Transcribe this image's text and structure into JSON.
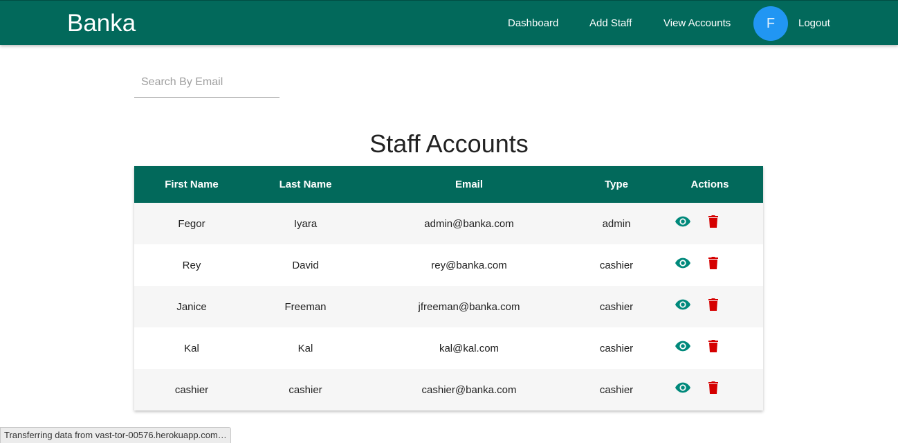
{
  "nav": {
    "brand": "Banka",
    "links": {
      "dashboard": "Dashboard",
      "add_staff": "Add Staff",
      "view_accounts": "View Accounts",
      "logout": "Logout"
    },
    "avatar_letter": "F"
  },
  "search": {
    "placeholder": "Search By Email",
    "value": ""
  },
  "page_title": "Staff Accounts",
  "table": {
    "headers": [
      "First Name",
      "Last Name",
      "Email",
      "Type",
      "Actions"
    ],
    "rows": [
      {
        "first": "Fegor",
        "last": "Iyara",
        "email": "admin@banka.com",
        "type": "admin"
      },
      {
        "first": "Rey",
        "last": "David",
        "email": "rey@banka.com",
        "type": "cashier"
      },
      {
        "first": "Janice",
        "last": "Freeman",
        "email": "jfreeman@banka.com",
        "type": "cashier"
      },
      {
        "first": "Kal",
        "last": "Kal",
        "email": "kal@kal.com",
        "type": "cashier"
      },
      {
        "first": "cashier",
        "last": "cashier",
        "email": "cashier@banka.com",
        "type": "cashier"
      }
    ],
    "action_icons": {
      "view": "eye-icon",
      "delete": "trash-icon"
    }
  },
  "colors": {
    "primary": "#02695b",
    "avatar": "#2196f3",
    "view_icon": "#00897b",
    "delete_icon": "#d50000"
  },
  "status_bar": "Transferring data from vast-tor-00576.herokuapp.com…"
}
